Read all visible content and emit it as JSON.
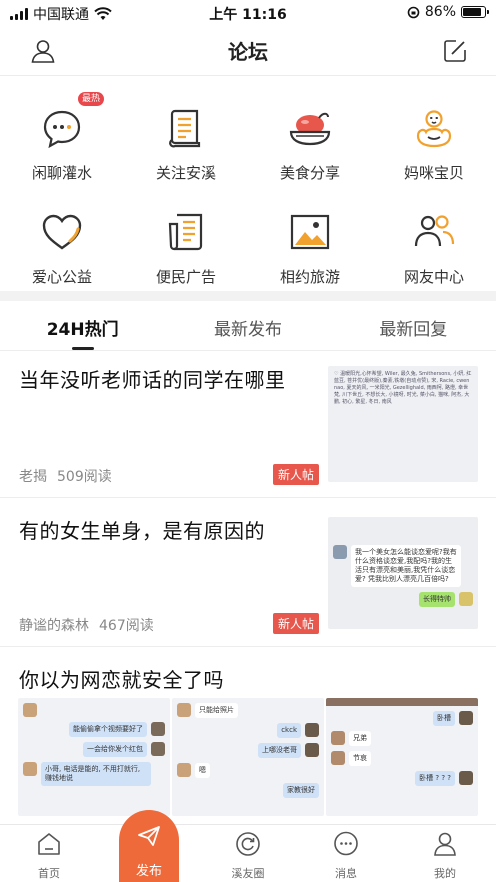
{
  "status_bar": {
    "carrier": "中国联通",
    "time": "上午 11:16",
    "battery": "86%",
    "battery_level": 0.86
  },
  "nav": {
    "title": "论坛"
  },
  "categories": [
    {
      "label": "闲聊灌水",
      "icon": "chat-bubble-icon",
      "badge": "最热"
    },
    {
      "label": "关注安溪",
      "icon": "news-book-icon"
    },
    {
      "label": "美食分享",
      "icon": "roast-chicken-icon"
    },
    {
      "label": "妈咪宝贝",
      "icon": "baby-icon"
    },
    {
      "label": "爱心公益",
      "icon": "heart-icon"
    },
    {
      "label": "便民广告",
      "icon": "notice-board-icon"
    },
    {
      "label": "相约旅游",
      "icon": "landscape-photo-icon"
    },
    {
      "label": "网友中心",
      "icon": "users-icon"
    }
  ],
  "tabs": [
    {
      "label": "24H热门",
      "active": true
    },
    {
      "label": "最新发布",
      "active": false
    },
    {
      "label": "最新回复",
      "active": false
    }
  ],
  "posts": [
    {
      "title": "当年没听老师话的同学在哪里",
      "author": "老揭",
      "reads": "509阅读",
      "badge": "新人帖",
      "thumb_text": "♡ 温暖阳光,心怀希望, Wiler, 最久兔, Smithersons, 小妍, 红蓝豆, 苍井优(最终版),秦素,铁墩(自动点赞), 宋, Racie, cwen nao, 夏天的风, 一米阳光, Gezellighald, 雨西柯, 路燈, 幸世梵, 川下世丘, 不想长大, 小镜呀, 时光, 菜小白, 猫咪, 阿杰, 大鹏, 初心, 繁星, 冬日, 南风"
    },
    {
      "title": "有的女生单身，是有原因的",
      "author": "静谧的森林",
      "reads": "467阅读",
      "badge": "新人帖",
      "chat": [
        "我一个美女怎么能谈恋爱呢?我有什么资格谈恋爱,我配吗?我的生活只有漂亮和美丽,我凭什么谈恋爱? 凭我比别人漂亮几百倍吗?",
        "长得特帅"
      ]
    },
    {
      "title": "你以为网恋就安全了吗",
      "chat_a": [
        "能偷偷拿个视频要好了",
        "一会给你发个红包",
        "小哥, 电话是能的, 不用打就行, 赚钱地说"
      ],
      "chat_b": [
        "只能给照片",
        "ckck",
        "上哪没老哥",
        "嗯",
        "家教很好"
      ],
      "chat_c": [
        "卧槽",
        "兄弟",
        "节哀",
        "卧槽 ? ? ?"
      ]
    }
  ],
  "bottom_tabs": [
    {
      "label": "首页",
      "icon": "home-icon"
    },
    {
      "label": "发布",
      "icon": "send-icon"
    },
    {
      "label": "溪友圈",
      "icon": "circle-refresh-icon"
    },
    {
      "label": "消息",
      "icon": "message-icon"
    },
    {
      "label": "我的",
      "icon": "user-icon"
    }
  ]
}
